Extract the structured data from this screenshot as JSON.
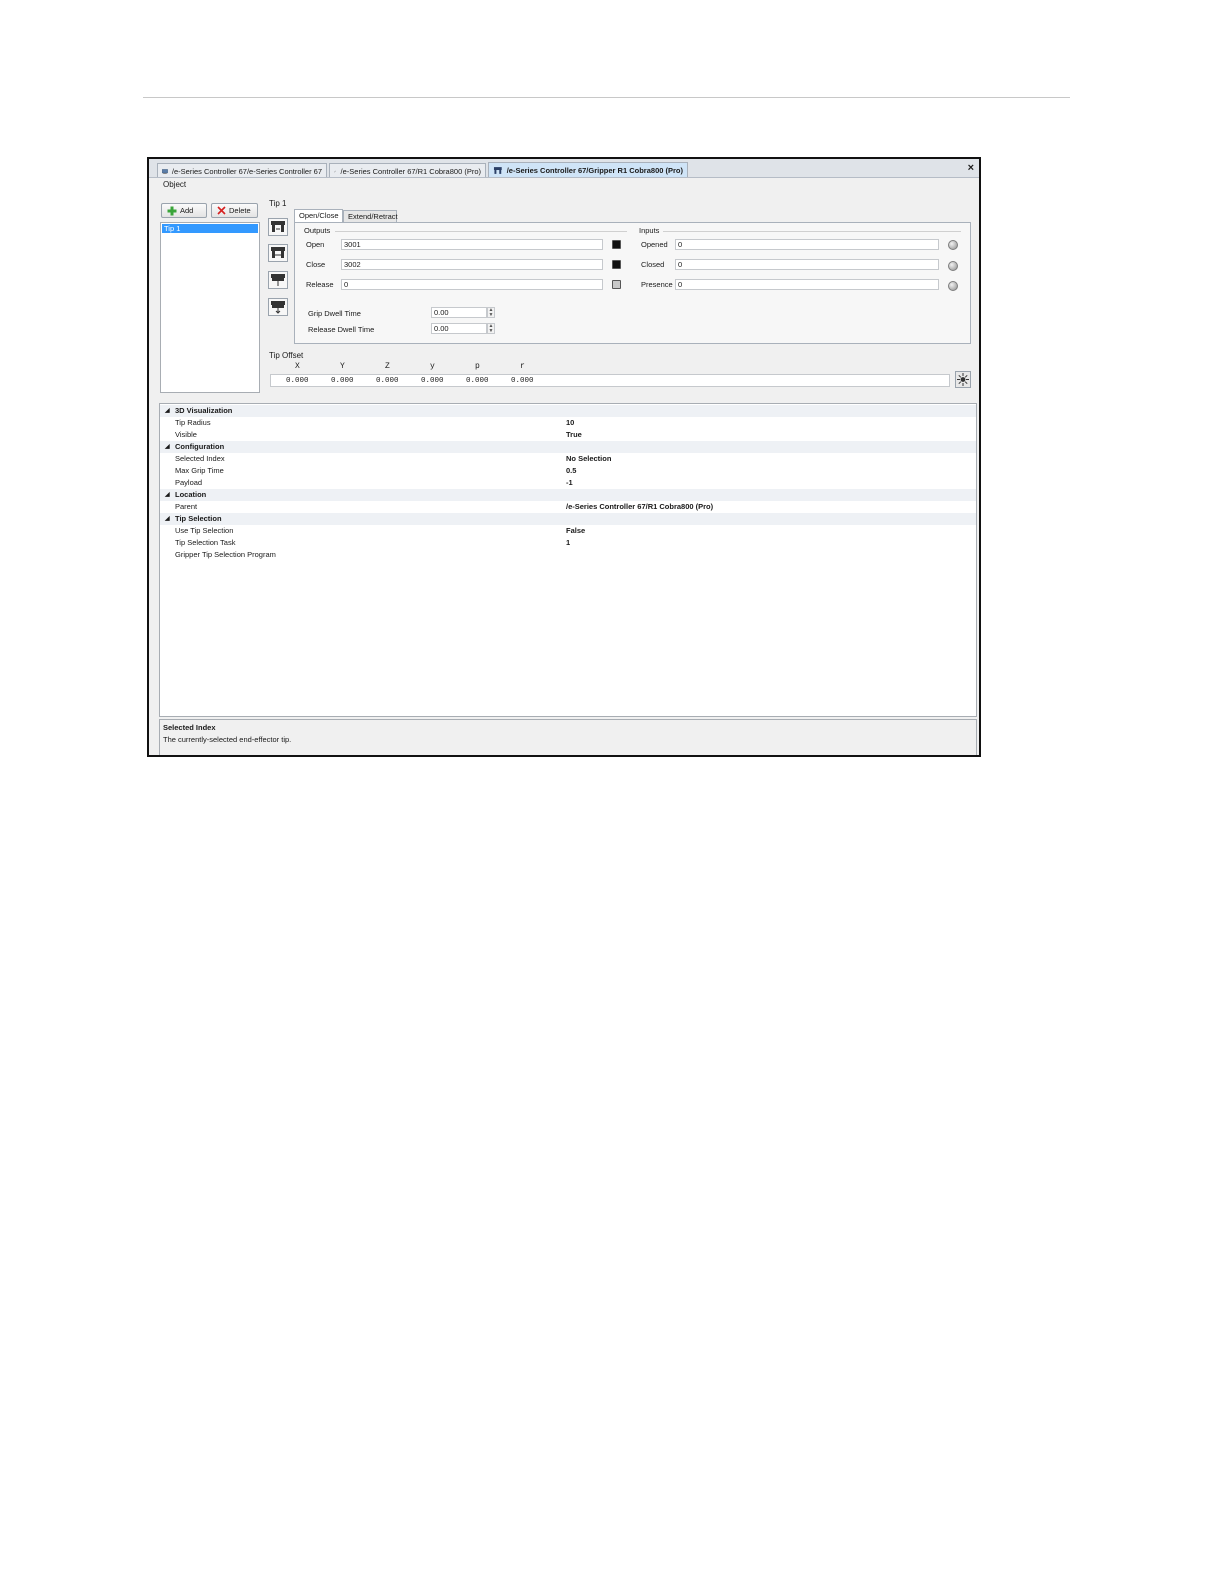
{
  "window": {
    "tabs": [
      {
        "label": "/e-Series Controller 67/e-Series Controller 67"
      },
      {
        "label": "/e-Series Controller 67/R1 Cobra800 (Pro)"
      },
      {
        "label": "/e-Series Controller 67/Gripper R1 Cobra800 (Pro)"
      }
    ],
    "close_glyph": "×",
    "menu_object": "Object"
  },
  "tip_list": {
    "add_label": "Add",
    "delete_label": "Delete",
    "items": [
      "Tip 1"
    ]
  },
  "editor": {
    "title": "Tip 1",
    "subtabs": [
      "Open/Close",
      "Extend/Retract"
    ],
    "outputs": {
      "label": "Outputs",
      "rows": [
        {
          "label": "Open",
          "value": "3001",
          "led_color": "#111111"
        },
        {
          "label": "Close",
          "value": "3002",
          "led_color": "#111111"
        },
        {
          "label": "Release",
          "value": "0",
          "led_color": "#c8c8c8"
        }
      ]
    },
    "inputs": {
      "label": "Inputs",
      "rows": [
        {
          "label": "Opened",
          "value": "0"
        },
        {
          "label": "Closed",
          "value": "0"
        },
        {
          "label": "Presence",
          "value": "0"
        }
      ]
    },
    "dwell": [
      {
        "label": "Grip Dwell Time",
        "value": "0.00"
      },
      {
        "label": "Release Dwell Time",
        "value": "0.00"
      }
    ]
  },
  "tip_offset": {
    "label": "Tip Offset",
    "axes": [
      "X",
      "Y",
      "Z",
      "y",
      "p",
      "r"
    ],
    "values": [
      "0.000",
      "0.000",
      "0.000",
      "0.000",
      "0.000",
      "0.000"
    ]
  },
  "properties": {
    "categories": [
      {
        "name": "3D Visualization",
        "items": [
          {
            "name": "Tip Radius",
            "value": "10"
          },
          {
            "name": "Visible",
            "value": "True"
          }
        ]
      },
      {
        "name": "Configuration",
        "items": [
          {
            "name": "Selected Index",
            "value": "No Selection"
          },
          {
            "name": "Max Grip Time",
            "value": "0.5"
          },
          {
            "name": "Payload",
            "value": "-1"
          }
        ]
      },
      {
        "name": "Location",
        "items": [
          {
            "name": "Parent",
            "value": "/e-Series Controller 67/R1 Cobra800 (Pro)"
          }
        ]
      },
      {
        "name": "Tip Selection",
        "items": [
          {
            "name": "Use Tip Selection",
            "value": "False"
          },
          {
            "name": "Tip Selection Task",
            "value": "1"
          },
          {
            "name": "Gripper Tip Selection Program",
            "value": ""
          }
        ]
      }
    ]
  },
  "description": {
    "title": "Selected Index",
    "text": "The currently-selected end-effector tip."
  },
  "colors": {
    "selection": "#3399ff",
    "active_tab": "#cfe4f7",
    "add_icon": "#3aa53a",
    "delete_icon": "#d62020"
  }
}
